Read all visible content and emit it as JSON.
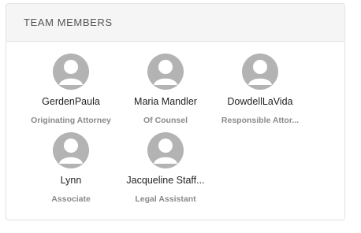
{
  "panel": {
    "title": "TEAM MEMBERS"
  },
  "members": [
    {
      "name": "GerdenPaula",
      "role": "Originating Attorney",
      "icon": "user-avatar-icon"
    },
    {
      "name": "Maria Mandler",
      "role": "Of Counsel",
      "icon": "user-avatar-icon"
    },
    {
      "name": "DowdellLaVida",
      "role": "Responsible Attor...",
      "icon": "user-avatar-icon"
    },
    {
      "name": "Lynn",
      "role": "Associate",
      "icon": "user-avatar-icon"
    },
    {
      "name": "Jacqueline Staff...",
      "role": "Legal Assistant",
      "icon": "user-avatar-icon"
    }
  ],
  "colors": {
    "avatar_fill": "#b3b3b3",
    "header_bg": "#f5f5f5",
    "border": "#e3e3e3"
  }
}
